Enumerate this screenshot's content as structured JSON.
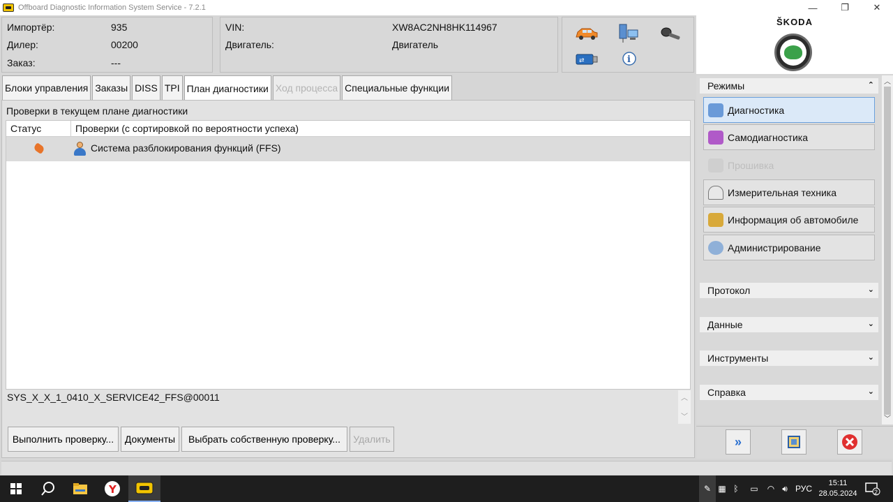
{
  "window": {
    "title": "Offboard Diagnostic Information System Service - 7.2.1",
    "controls": [
      "—",
      "❐",
      "✕"
    ]
  },
  "header": {
    "importer_label": "Импортёр:",
    "importer_value": "935",
    "dealer_label": "Дилер:",
    "dealer_value": "00200",
    "order_label": "Заказ:",
    "order_value": "---",
    "vin_label": "VIN:",
    "vin_value": "XW8AC2NH8HK114967",
    "engine_label": "Двигатель:",
    "engine_value": "Двигатель"
  },
  "brand": {
    "name": "ŠKODA"
  },
  "tabs": [
    {
      "label": "Блоки управления",
      "state": "normal"
    },
    {
      "label": "Заказы",
      "state": "normal"
    },
    {
      "label": "DISS",
      "state": "normal"
    },
    {
      "label": "TPI",
      "state": "normal"
    },
    {
      "label": "План диагностики",
      "state": "active"
    },
    {
      "label": "Ход процесса",
      "state": "disabled"
    },
    {
      "label": "Специальные функции",
      "state": "normal"
    }
  ],
  "plan": {
    "title": "Проверки в текущем плане диагностики",
    "columns": {
      "status": "Статус",
      "checks": "Проверки (с сортировкой по вероятности успеха)"
    },
    "rows": [
      {
        "name": "Система разблокирования функций (FFS)"
      }
    ],
    "code": "SYS_X_X_1_0410_X_SERVICE42_FFS@00011"
  },
  "buttons": {
    "run": "Выполнить проверку...",
    "docs": "Документы",
    "choose": "Выбрать собственную проверку...",
    "delete": "Удалить"
  },
  "sidebar": {
    "modes_title": "Режимы",
    "modes": [
      {
        "label": "Диагностика",
        "state": "selected"
      },
      {
        "label": "Самодиагностика",
        "state": "normal"
      },
      {
        "label": "Прошивка",
        "state": "disabled"
      },
      {
        "label": "Измерительная техника",
        "state": "normal"
      },
      {
        "label": "Информация об автомобиле",
        "state": "normal"
      },
      {
        "label": "Администрирование",
        "state": "normal"
      }
    ],
    "sections": [
      "Протокол",
      "Данные",
      "Инструменты",
      "Справка"
    ]
  },
  "taskbar": {
    "lang": "РУС",
    "time": "15:11",
    "date": "28.05.2024",
    "notifications": "2"
  },
  "colors": {
    "accent_select": "#dbe9f8",
    "status_icon": "#e8742a",
    "skoda_green": "#3ba14a"
  }
}
